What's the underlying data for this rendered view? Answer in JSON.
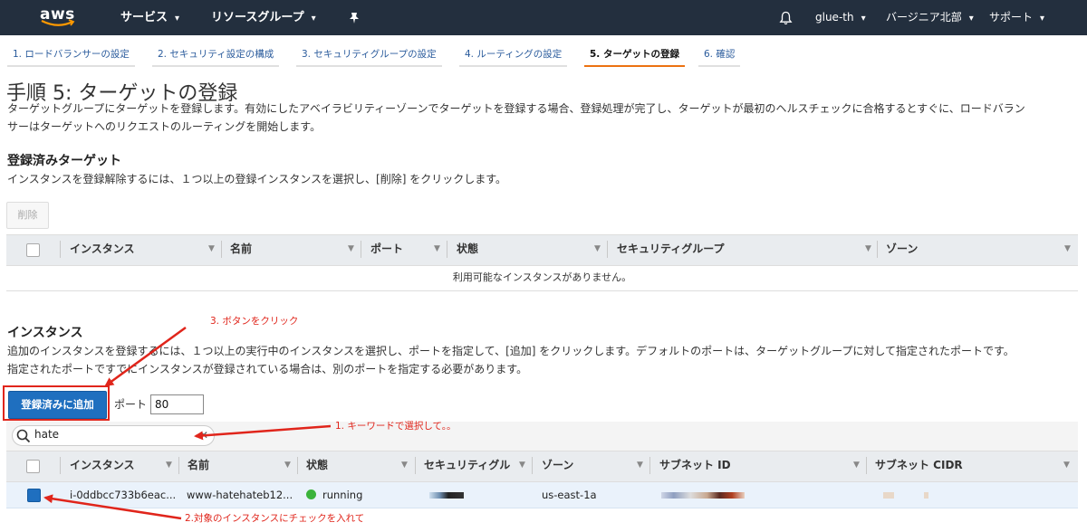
{
  "topnav": {
    "logo_text": "aws",
    "services": "サービス",
    "resource_groups": "リソースグループ",
    "user": "glue-th",
    "region": "バージニア北部",
    "support": "サポート"
  },
  "tabs": [
    {
      "label": "1. ロードバランサーの設定"
    },
    {
      "label": "2. セキュリティ設定の構成"
    },
    {
      "label": "3. セキュリティグループの設定"
    },
    {
      "label": "4. ルーティングの設定"
    },
    {
      "label": "5. ターゲットの登録",
      "active": true
    },
    {
      "label": "6. 確認"
    }
  ],
  "page": {
    "title": "手順 5: ターゲットの登録",
    "desc_line1": "ターゲットグループにターゲットを登録します。有効にしたアベイラビリティーゾーンでターゲットを登録する場合、登録処理が完了し、ターゲットが最初のヘルスチェックに合格するとすぐに、ロードバラン",
    "desc_line2": "サーはターゲットへのリクエストのルーティングを開始します。"
  },
  "registered": {
    "heading": "登録済みターゲット",
    "desc": "インスタンスを登録解除するには、１つ以上の登録インスタンスを選択し、[削除] をクリックします。",
    "remove_button": "削除",
    "columns": [
      "インスタンス",
      "名前",
      "ポート",
      "状態",
      "セキュリティグループ",
      "ゾーン"
    ],
    "empty_text": "利用可能なインスタンスがありません。"
  },
  "instances": {
    "heading": "インスタンス",
    "desc_line1": "追加のインスタンスを登録するには、１つ以上の実行中のインスタンスを選択し、ポートを指定して、[追加] をクリックします。デフォルトのポートは、ターゲットグループに対して指定されたポートです。",
    "desc_line2": "指定されたポートですでにインスタンスが登録されている場合は、別のポートを指定する必要があります。",
    "add_button": "登録済みに追加",
    "port_label": "ポート",
    "port_value": "80",
    "search_value": "hate",
    "columns": [
      "インスタンス",
      "名前",
      "状態",
      "セキュリティグル",
      "ゾーン",
      "サブネット ID",
      "サブネット CIDR"
    ],
    "rows": [
      {
        "instance": "i-0ddbcc733b6eac...",
        "name": "www-hatehateb12...",
        "state": "running",
        "zone": "us-east-1a",
        "checked": true
      }
    ]
  },
  "annotations": {
    "step1": "1. キーワードで選択して。。",
    "step2": "2.対象のインスタンスにチェックを入れて",
    "step3": "3. ボタンをクリック"
  },
  "colors": {
    "nav_bg": "#232f3e",
    "accent_orange": "#ec7211",
    "primary_button": "#1f6fbf",
    "annotation_red": "#e0251b",
    "running_green": "#3bb33b"
  }
}
